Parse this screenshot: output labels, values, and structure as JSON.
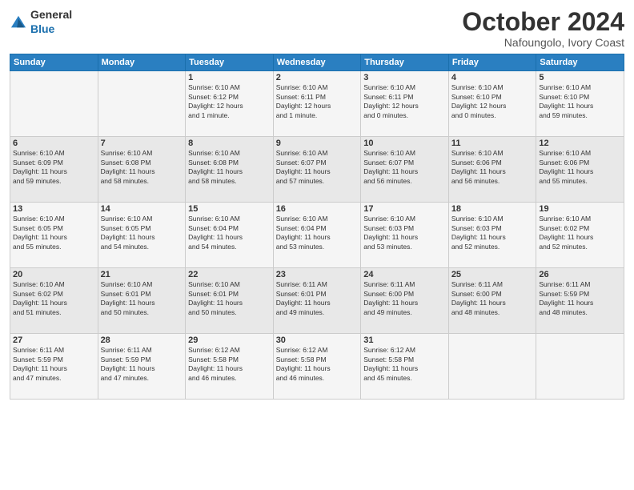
{
  "logo": {
    "general": "General",
    "blue": "Blue"
  },
  "title": "October 2024",
  "location": "Nafoungolo, Ivory Coast",
  "days_header": [
    "Sunday",
    "Monday",
    "Tuesday",
    "Wednesday",
    "Thursday",
    "Friday",
    "Saturday"
  ],
  "weeks": [
    [
      {
        "day": "",
        "info": ""
      },
      {
        "day": "",
        "info": ""
      },
      {
        "day": "1",
        "info": "Sunrise: 6:10 AM\nSunset: 6:12 PM\nDaylight: 12 hours\nand 1 minute."
      },
      {
        "day": "2",
        "info": "Sunrise: 6:10 AM\nSunset: 6:11 PM\nDaylight: 12 hours\nand 1 minute."
      },
      {
        "day": "3",
        "info": "Sunrise: 6:10 AM\nSunset: 6:11 PM\nDaylight: 12 hours\nand 0 minutes."
      },
      {
        "day": "4",
        "info": "Sunrise: 6:10 AM\nSunset: 6:10 PM\nDaylight: 12 hours\nand 0 minutes."
      },
      {
        "day": "5",
        "info": "Sunrise: 6:10 AM\nSunset: 6:10 PM\nDaylight: 11 hours\nand 59 minutes."
      }
    ],
    [
      {
        "day": "6",
        "info": "Sunrise: 6:10 AM\nSunset: 6:09 PM\nDaylight: 11 hours\nand 59 minutes."
      },
      {
        "day": "7",
        "info": "Sunrise: 6:10 AM\nSunset: 6:08 PM\nDaylight: 11 hours\nand 58 minutes."
      },
      {
        "day": "8",
        "info": "Sunrise: 6:10 AM\nSunset: 6:08 PM\nDaylight: 11 hours\nand 58 minutes."
      },
      {
        "day": "9",
        "info": "Sunrise: 6:10 AM\nSunset: 6:07 PM\nDaylight: 11 hours\nand 57 minutes."
      },
      {
        "day": "10",
        "info": "Sunrise: 6:10 AM\nSunset: 6:07 PM\nDaylight: 11 hours\nand 56 minutes."
      },
      {
        "day": "11",
        "info": "Sunrise: 6:10 AM\nSunset: 6:06 PM\nDaylight: 11 hours\nand 56 minutes."
      },
      {
        "day": "12",
        "info": "Sunrise: 6:10 AM\nSunset: 6:06 PM\nDaylight: 11 hours\nand 55 minutes."
      }
    ],
    [
      {
        "day": "13",
        "info": "Sunrise: 6:10 AM\nSunset: 6:05 PM\nDaylight: 11 hours\nand 55 minutes."
      },
      {
        "day": "14",
        "info": "Sunrise: 6:10 AM\nSunset: 6:05 PM\nDaylight: 11 hours\nand 54 minutes."
      },
      {
        "day": "15",
        "info": "Sunrise: 6:10 AM\nSunset: 6:04 PM\nDaylight: 11 hours\nand 54 minutes."
      },
      {
        "day": "16",
        "info": "Sunrise: 6:10 AM\nSunset: 6:04 PM\nDaylight: 11 hours\nand 53 minutes."
      },
      {
        "day": "17",
        "info": "Sunrise: 6:10 AM\nSunset: 6:03 PM\nDaylight: 11 hours\nand 53 minutes."
      },
      {
        "day": "18",
        "info": "Sunrise: 6:10 AM\nSunset: 6:03 PM\nDaylight: 11 hours\nand 52 minutes."
      },
      {
        "day": "19",
        "info": "Sunrise: 6:10 AM\nSunset: 6:02 PM\nDaylight: 11 hours\nand 52 minutes."
      }
    ],
    [
      {
        "day": "20",
        "info": "Sunrise: 6:10 AM\nSunset: 6:02 PM\nDaylight: 11 hours\nand 51 minutes."
      },
      {
        "day": "21",
        "info": "Sunrise: 6:10 AM\nSunset: 6:01 PM\nDaylight: 11 hours\nand 50 minutes."
      },
      {
        "day": "22",
        "info": "Sunrise: 6:10 AM\nSunset: 6:01 PM\nDaylight: 11 hours\nand 50 minutes."
      },
      {
        "day": "23",
        "info": "Sunrise: 6:11 AM\nSunset: 6:01 PM\nDaylight: 11 hours\nand 49 minutes."
      },
      {
        "day": "24",
        "info": "Sunrise: 6:11 AM\nSunset: 6:00 PM\nDaylight: 11 hours\nand 49 minutes."
      },
      {
        "day": "25",
        "info": "Sunrise: 6:11 AM\nSunset: 6:00 PM\nDaylight: 11 hours\nand 48 minutes."
      },
      {
        "day": "26",
        "info": "Sunrise: 6:11 AM\nSunset: 5:59 PM\nDaylight: 11 hours\nand 48 minutes."
      }
    ],
    [
      {
        "day": "27",
        "info": "Sunrise: 6:11 AM\nSunset: 5:59 PM\nDaylight: 11 hours\nand 47 minutes."
      },
      {
        "day": "28",
        "info": "Sunrise: 6:11 AM\nSunset: 5:59 PM\nDaylight: 11 hours\nand 47 minutes."
      },
      {
        "day": "29",
        "info": "Sunrise: 6:12 AM\nSunset: 5:58 PM\nDaylight: 11 hours\nand 46 minutes."
      },
      {
        "day": "30",
        "info": "Sunrise: 6:12 AM\nSunset: 5:58 PM\nDaylight: 11 hours\nand 46 minutes."
      },
      {
        "day": "31",
        "info": "Sunrise: 6:12 AM\nSunset: 5:58 PM\nDaylight: 11 hours\nand 45 minutes."
      },
      {
        "day": "",
        "info": ""
      },
      {
        "day": "",
        "info": ""
      }
    ]
  ]
}
